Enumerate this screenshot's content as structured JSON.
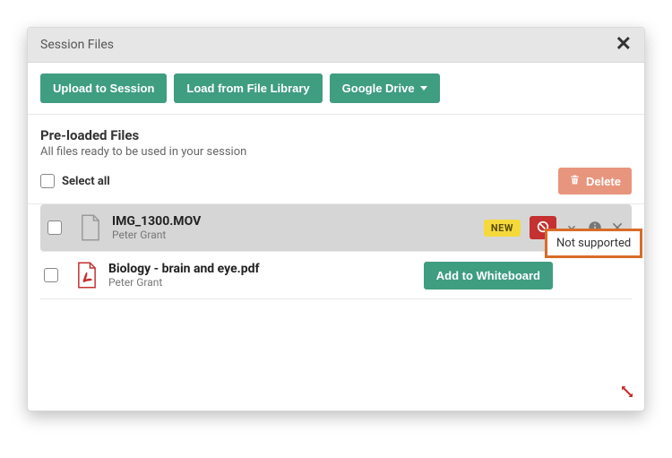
{
  "dialog": {
    "title": "Session Files",
    "close_label": "Close"
  },
  "actions": {
    "upload": "Upload to Session",
    "load_library": "Load from File Library",
    "google_drive": "Google Drive"
  },
  "preloaded": {
    "title": "Pre-loaded Files",
    "subtitle": "All files ready to be used in your session",
    "select_all": "Select all",
    "delete": "Delete"
  },
  "files": [
    {
      "name": "IMG_1300.MOV",
      "owner": "Peter Grant",
      "is_new": true,
      "new_label": "NEW",
      "supported": false
    },
    {
      "name": "Biology - brain and eye.pdf",
      "owner": "Peter Grant",
      "is_new": false,
      "supported": true
    }
  ],
  "row_actions": {
    "add_to_whiteboard": "Add to Whiteboard",
    "not_supported_tooltip": "Not supported"
  },
  "icons": {
    "close": "close-icon",
    "caret": "chevron-down-icon",
    "trash": "trash-icon",
    "blocked": "blocked-icon",
    "download": "download-icon",
    "info": "info-icon",
    "remove": "close-icon",
    "pdf": "pdf-icon",
    "generic_file": "file-icon",
    "resize": "resize-icon"
  }
}
